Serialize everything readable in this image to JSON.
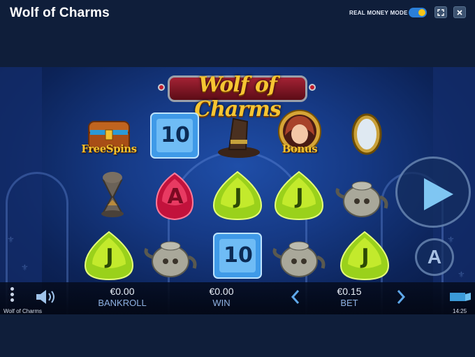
{
  "header": {
    "title": "Wolf of Charms",
    "mode_label": "REAL MONEY MODE",
    "mode_on": true
  },
  "game": {
    "logo_text": "Wolf of Charms",
    "reels": [
      [
        "freespins-chest",
        "teapot-hourglass",
        "green-j"
      ],
      [
        "blue-10",
        "red-a",
        "teapot"
      ],
      [
        "wolf-hat",
        "green-j",
        "blue-10"
      ],
      [
        "bonus-girl",
        "green-j",
        "teapot"
      ],
      [
        "mirror",
        "teapot",
        "green-j"
      ]
    ],
    "symbol_text": {
      "freespins": "FreeSpins",
      "bonus": "Bonus",
      "ten": "10",
      "j": "J",
      "a": "A"
    },
    "auto_label": "A"
  },
  "footer": {
    "bankroll_value": "€0.00",
    "bankroll_label": "BANKROLL",
    "win_value": "€0.00",
    "win_label": "WIN",
    "bet_value": "€0.15",
    "bet_label": "BET",
    "game_name": "Wolf of Charms",
    "time": "14:25"
  },
  "colors": {
    "page_bg": "#0f1e3a",
    "toggle_on": "#2b7fd8",
    "toggle_knob": "#f5c518",
    "label_blue": "#8fb2e2"
  }
}
